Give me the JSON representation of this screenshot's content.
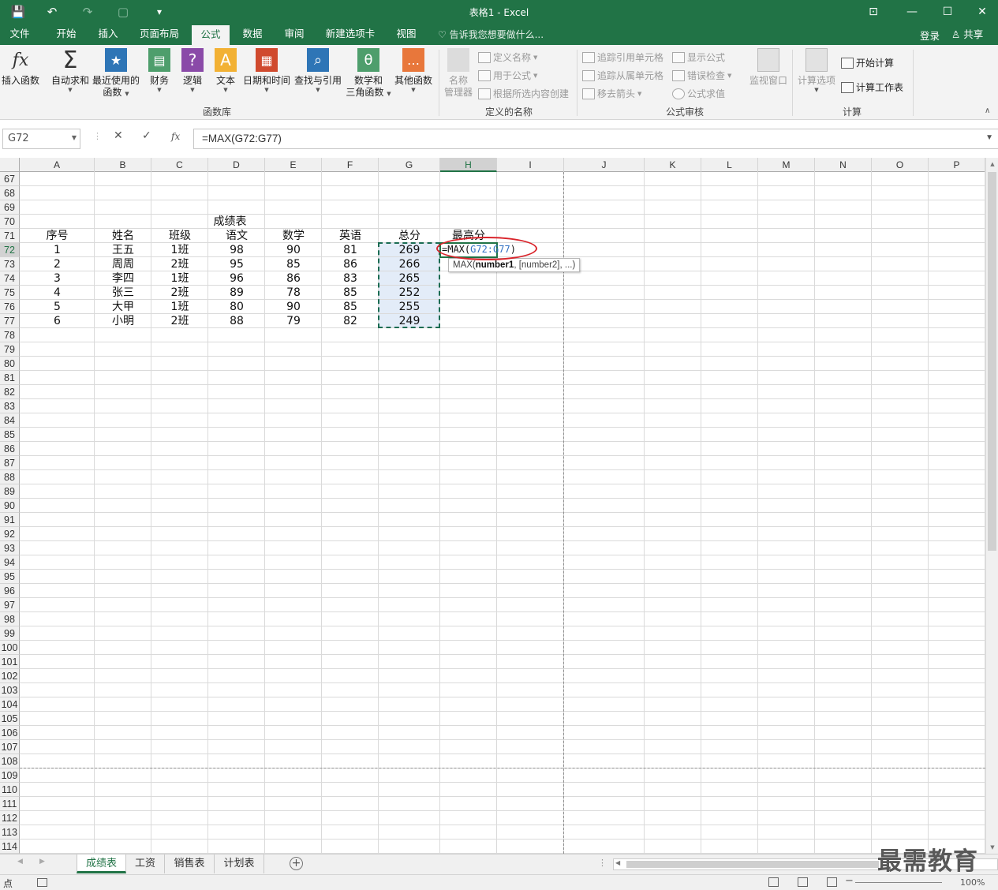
{
  "app": {
    "title": "表格1 - Excel",
    "quick_access": {
      "save": "💾",
      "undo": "↶",
      "redo": "↷",
      "new": "▢",
      "customize": "▾"
    },
    "window_controls": {
      "ribbon_options": "⊡",
      "minimize": "—",
      "maximize": "☐",
      "close": "✕"
    }
  },
  "tabs": [
    "文件",
    "开始",
    "插入",
    "页面布局",
    "公式",
    "数据",
    "审阅",
    "新建选项卡",
    "视图"
  ],
  "active_tab": "公式",
  "tell_me": "♡ 告诉我您想要做什么...",
  "account": {
    "login": "登录",
    "share": "共享",
    "share_icon": "♙"
  },
  "ribbon": {
    "function_library": {
      "group_label": "函数库",
      "insert_function": {
        "icon_text": "fx",
        "label": "插入函数"
      },
      "autosum": {
        "icon_text": "Σ",
        "label": "自动求和"
      },
      "recent": {
        "icon_text": "★",
        "label": "最近使用的",
        "label2": "函数"
      },
      "financial": {
        "icon_text": "▤",
        "label": "财务"
      },
      "logical": {
        "icon_text": "?",
        "label": "逻辑"
      },
      "text": {
        "icon_text": "A",
        "label": "文本"
      },
      "datetime": {
        "icon_text": "▦",
        "label": "日期和时间"
      },
      "lookup": {
        "icon_text": "⌕",
        "label": "查找与引用"
      },
      "math": {
        "icon_text": "θ",
        "label": "数学和",
        "label2": "三角函数"
      },
      "more": {
        "icon_text": "…",
        "label": "其他函数"
      }
    },
    "defined_names": {
      "group_label": "定义的名称",
      "name_manager": {
        "label": "名称",
        "label2": "管理器"
      },
      "define_name": "定义名称",
      "use_in_formula": "用于公式",
      "create_from_selection": "根据所选内容创建"
    },
    "formula_auditing": {
      "group_label": "公式审核",
      "trace_precedents": "追踪引用单元格",
      "trace_dependents": "追踪从属单元格",
      "remove_arrows": "移去箭头",
      "show_formulas": "显示公式",
      "error_checking": "错误检查",
      "evaluate_formula": "公式求值",
      "watch_window": "监视窗口"
    },
    "calculation": {
      "group_label": "计算",
      "calc_options": "计算选项",
      "calc_now": "开始计算",
      "calc_sheet": "计算工作表"
    }
  },
  "formula_bar": {
    "name_box": "G72",
    "cancel": "✕",
    "enter": "✓",
    "fx": "fx",
    "formula": "=MAX(G72:G77)"
  },
  "grid": {
    "columns": [
      "A",
      "B",
      "C",
      "D",
      "E",
      "F",
      "G",
      "H",
      "I",
      "J",
      "K",
      "L",
      "M",
      "N",
      "O",
      "P"
    ],
    "rows": [
      "67",
      "68",
      "69",
      "70",
      "71",
      "72",
      "73",
      "74",
      "75",
      "76",
      "77",
      "78",
      "79",
      "80",
      "81",
      "82",
      "83",
      "84",
      "85",
      "86",
      "87",
      "88",
      "89",
      "90",
      "91",
      "92",
      "93",
      "94",
      "95",
      "96",
      "97",
      "98",
      "99",
      "100",
      "101",
      "102",
      "103",
      "104",
      "105",
      "106",
      "107",
      "108",
      "109",
      "110",
      "111",
      "112",
      "113",
      "114"
    ],
    "table_title": "成绩表",
    "headers": [
      "序号",
      "姓名",
      "班级",
      "语文",
      "数学",
      "英语",
      "总分",
      "最高分"
    ],
    "data": [
      [
        "1",
        "王五",
        "1班",
        "98",
        "90",
        "81",
        "269"
      ],
      [
        "2",
        "周周",
        "2班",
        "95",
        "85",
        "86",
        "266"
      ],
      [
        "3",
        "李四",
        "1班",
        "96",
        "86",
        "83",
        "265"
      ],
      [
        "4",
        "张三",
        "2班",
        "89",
        "78",
        "85",
        "252"
      ],
      [
        "5",
        "大甲",
        "1班",
        "80",
        "90",
        "85",
        "255"
      ],
      [
        "6",
        "小明",
        "2班",
        "88",
        "79",
        "82",
        "249"
      ]
    ],
    "editing_cell": {
      "prefix": "=MAX(",
      "ref": "G72:G77",
      "suffix": ")"
    },
    "tooltip": {
      "fn": "MAX(",
      "arg1": "number1",
      "rest": ", [number2], ...)"
    }
  },
  "sheets": [
    "成绩表",
    "工资",
    "销售表",
    "计划表"
  ],
  "active_sheet": "成绩表",
  "status": {
    "mode": "点",
    "zoom": "100%"
  },
  "watermark": "最需教育"
}
